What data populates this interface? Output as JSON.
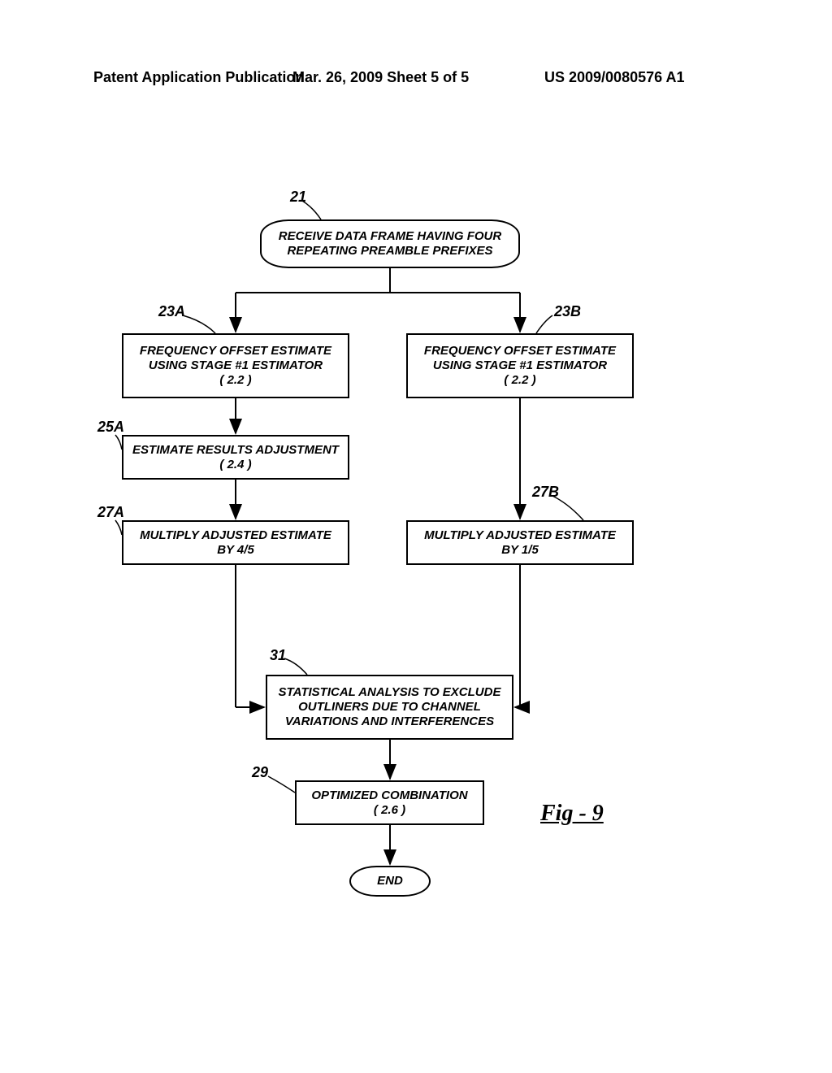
{
  "header": {
    "left": "Patent Application Publication",
    "mid": "Mar. 26, 2009  Sheet 5 of 5",
    "right": "US 2009/0080576 A1"
  },
  "nodes": {
    "start": {
      "line1": "RECEIVE DATA FRAME HAVING FOUR",
      "line2": "REPEATING PREAMBLE PREFIXES"
    },
    "n23A": {
      "line1": "FREQUENCY OFFSET ESTIMATE",
      "line2": "USING STAGE #1 ESTIMATOR",
      "line3": "( 2.2 )"
    },
    "n23B": {
      "line1": "FREQUENCY OFFSET ESTIMATE",
      "line2": "USING STAGE #1 ESTIMATOR",
      "line3": "( 2.2 )"
    },
    "n25A": {
      "line1": "ESTIMATE RESULTS ADJUSTMENT",
      "line2": "( 2.4 )"
    },
    "n27A": {
      "line1": "MULTIPLY ADJUSTED ESTIMATE",
      "line2": "BY 4/5"
    },
    "n27B": {
      "line1": "MULTIPLY ADJUSTED ESTIMATE",
      "line2": "BY 1/5"
    },
    "n31": {
      "line1": "STATISTICAL ANALYSIS TO EXCLUDE",
      "line2": "OUTLINERS DUE TO CHANNEL",
      "line3": "VARIATIONS AND INTERFERENCES"
    },
    "n29": {
      "line1": "OPTIMIZED COMBINATION",
      "line2": "( 2.6 )"
    },
    "end": {
      "line1": "END"
    }
  },
  "refs": {
    "r21": "21",
    "r23A": "23A",
    "r23B": "23B",
    "r25A": "25A",
    "r27A": "27A",
    "r27B": "27B",
    "r31": "31",
    "r29": "29"
  },
  "figure": "Fig - 9"
}
